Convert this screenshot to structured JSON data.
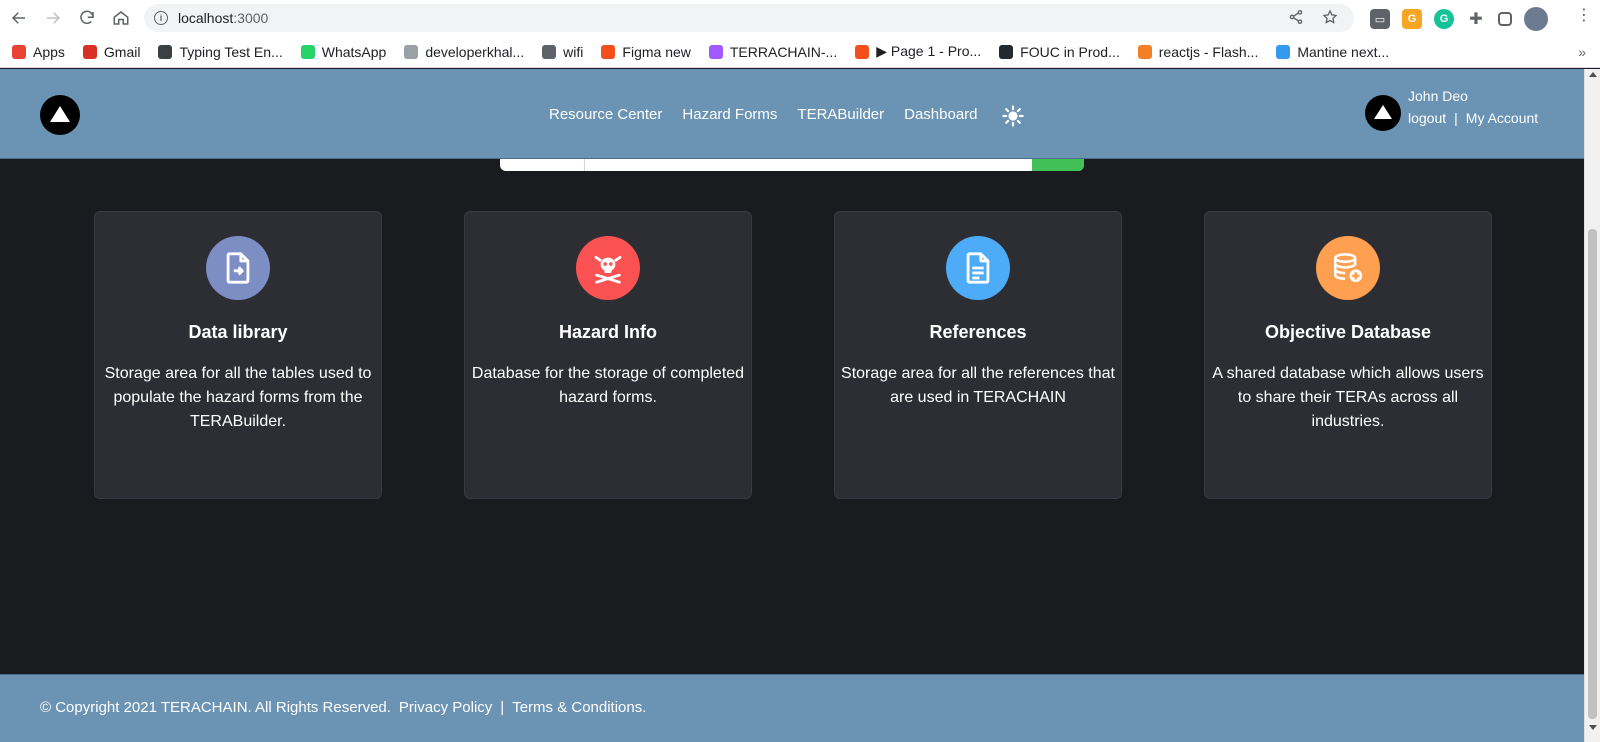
{
  "browser": {
    "url_host": "localhost",
    "url_port": ":3000",
    "bookmarks": [
      {
        "label": "Apps",
        "color": "#ea4335"
      },
      {
        "label": "Gmail",
        "color": "#d93025"
      },
      {
        "label": "Typing Test En...",
        "color": "#3c4043"
      },
      {
        "label": "WhatsApp",
        "color": "#25d366"
      },
      {
        "label": "developerkhal...",
        "color": "#9aa0a6"
      },
      {
        "label": "wifi",
        "color": "#5f6368"
      },
      {
        "label": "Figma new",
        "color": "#f24e1e"
      },
      {
        "label": "TERRACHAIN-...",
        "color": "#a259ff"
      },
      {
        "label": "▶ Page 1 - Pro...",
        "color": "#f24e1e"
      },
      {
        "label": "FOUC in Prod...",
        "color": "#24292e"
      },
      {
        "label": "reactjs - Flash...",
        "color": "#f48024"
      },
      {
        "label": "Mantine next...",
        "color": "#339af0"
      }
    ],
    "more": "»"
  },
  "header": {
    "nav": [
      {
        "label": "Resource Center"
      },
      {
        "label": "Hazard Forms"
      },
      {
        "label": "TERABuilder"
      },
      {
        "label": "Dashboard"
      }
    ],
    "theme_icon": "sun-icon",
    "user_name": "John Deo",
    "logout": "logout",
    "separator": "|",
    "my_account": "My Account"
  },
  "cards": [
    {
      "title": "Data library",
      "description": "Storage area for all the tables used to populate the hazard forms from the TERABuilder.",
      "icon": "file-import-icon",
      "color": "#7d8ec4"
    },
    {
      "title": "Hazard Info",
      "description": "Database for the storage of completed hazard forms.",
      "icon": "skull-crossbones-icon",
      "color": "#fa5252"
    },
    {
      "title": "References",
      "description": "Storage area for all the references that are used in TERACHAIN",
      "icon": "document-icon",
      "color": "#4dabf7"
    },
    {
      "title": "Objective Database",
      "description": "A shared database which allows users to share their TERAs across all industries.",
      "icon": "database-add-icon",
      "color": "#ff9f50"
    }
  ],
  "footer": {
    "copyright": "© Copyright 2021 TERACHAIN. All Rights Reserved.",
    "privacy": "Privacy Policy",
    "separator": "|",
    "terms": "Terms & Conditions."
  },
  "colors": {
    "header_bg": "#6b93b4",
    "page_bg": "#1a1b1e",
    "card_bg": "#2c2e33"
  }
}
